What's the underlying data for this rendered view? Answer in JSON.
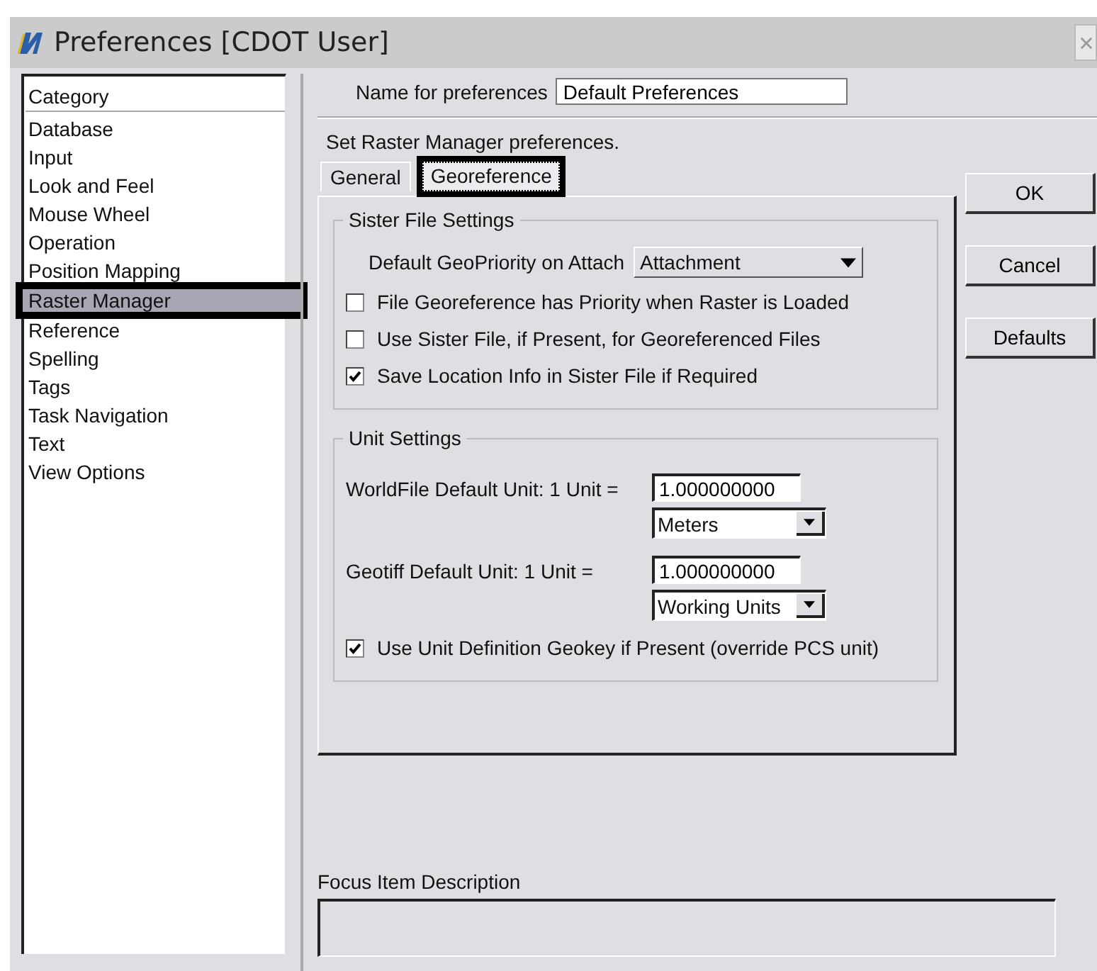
{
  "window": {
    "title": "Preferences [CDOT User]"
  },
  "category_list": {
    "header": "Category",
    "items": [
      {
        "label": "Database",
        "selected": false
      },
      {
        "label": "Input",
        "selected": false
      },
      {
        "label": "Look and Feel",
        "selected": false
      },
      {
        "label": "Mouse Wheel",
        "selected": false
      },
      {
        "label": "Operation",
        "selected": false
      },
      {
        "label": "Position Mapping",
        "selected": false
      },
      {
        "label": "Raster Manager",
        "selected": true
      },
      {
        "label": "Reference",
        "selected": false
      },
      {
        "label": "Spelling",
        "selected": false
      },
      {
        "label": "Tags",
        "selected": false
      },
      {
        "label": "Task Navigation",
        "selected": false
      },
      {
        "label": "Text",
        "selected": false
      },
      {
        "label": "View Options",
        "selected": false
      }
    ]
  },
  "name_field": {
    "label": "Name for preferences",
    "value": "Default Preferences"
  },
  "description": "Set Raster Manager preferences.",
  "tabs": [
    {
      "label": "General",
      "selected": false
    },
    {
      "label": "Georeference",
      "selected": true
    }
  ],
  "sister_file_settings": {
    "title": "Sister File Settings",
    "priority_label": "Default GeoPriority on Attach",
    "priority_value": "Attachment",
    "checkboxes": [
      {
        "label": "File Georeference has Priority when Raster is Loaded",
        "checked": false
      },
      {
        "label": "Use Sister File, if Present, for Georeferenced Files",
        "checked": false
      },
      {
        "label": "Save Location Info in Sister File if Required",
        "checked": true
      }
    ]
  },
  "unit_settings": {
    "title": "Unit Settings",
    "units": [
      {
        "label": "WorldFile Default Unit: 1 Unit =",
        "value": "1.000000000",
        "unit": "Meters"
      },
      {
        "label": "Geotiff Default Unit: 1 Unit =",
        "value": "1.000000000",
        "unit": "Working Units"
      }
    ],
    "checkbox": {
      "label": "Use Unit Definition Geokey if Present (override PCS unit)",
      "checked": true
    }
  },
  "buttons": [
    "OK",
    "Cancel",
    "Defaults"
  ],
  "focus_description": {
    "label": "Focus Item Description"
  }
}
